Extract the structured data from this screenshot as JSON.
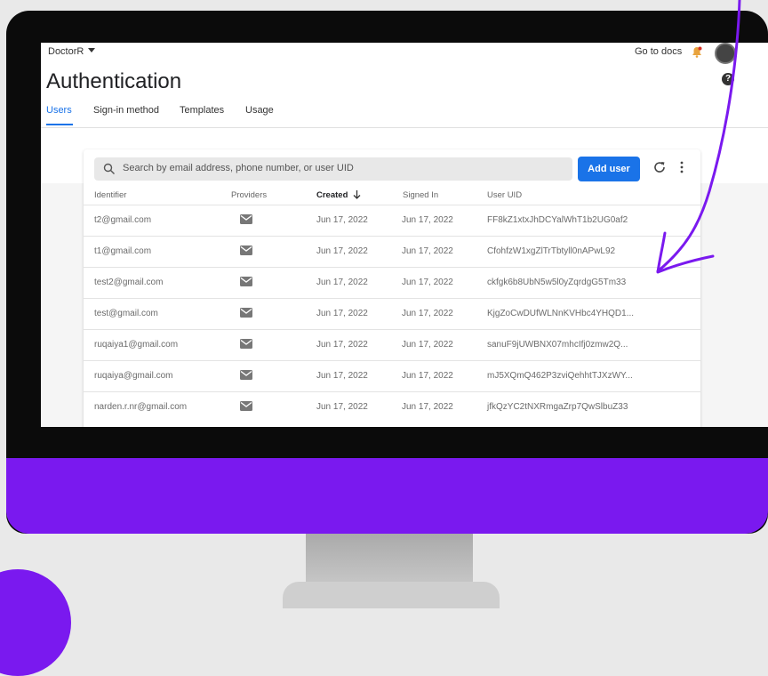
{
  "header": {
    "project": "DoctorR",
    "docs_link": "Go to docs",
    "title": "Authentication"
  },
  "tabs": [
    {
      "label": "Users",
      "active": true
    },
    {
      "label": "Sign-in method",
      "active": false
    },
    {
      "label": "Templates",
      "active": false
    },
    {
      "label": "Usage",
      "active": false
    }
  ],
  "search": {
    "placeholder": "Search by email address, phone number, or user UID"
  },
  "toolbar": {
    "add_user_label": "Add user"
  },
  "table": {
    "columns": [
      "Identifier",
      "Providers",
      "Created",
      "Signed In",
      "User UID"
    ],
    "sort_column": "Created",
    "sort_direction": "descending",
    "rows": [
      {
        "identifier": "t2@gmail.com",
        "provider": "email-icon",
        "created": "Jun 17, 2022",
        "signed_in": "Jun 17, 2022",
        "uid": "FF8kZ1xtxJhDCYalWhT1b2UG0af2"
      },
      {
        "identifier": "t1@gmail.com",
        "provider": "email-icon",
        "created": "Jun 17, 2022",
        "signed_in": "Jun 17, 2022",
        "uid": "CfohfzW1xgZlTrTbtyll0nAPwL92"
      },
      {
        "identifier": "test2@gmail.com",
        "provider": "email-icon",
        "created": "Jun 17, 2022",
        "signed_in": "Jun 17, 2022",
        "uid": "ckfgk6b8UbN5w5l0yZqrdgG5Tm33"
      },
      {
        "identifier": "test@gmail.com",
        "provider": "email-icon",
        "created": "Jun 17, 2022",
        "signed_in": "Jun 17, 2022",
        "uid": "KjgZoCwDUfWLNnKVHbc4YHQD1..."
      },
      {
        "identifier": "ruqaiya1@gmail.com",
        "provider": "email-icon",
        "created": "Jun 17, 2022",
        "signed_in": "Jun 17, 2022",
        "uid": "sanuF9jUWBNX07mhcIfj0zmw2Q..."
      },
      {
        "identifier": "ruqaiya@gmail.com",
        "provider": "email-icon",
        "created": "Jun 17, 2022",
        "signed_in": "Jun 17, 2022",
        "uid": "mJ5XQmQ462P3zviQehhtTJXzWY..."
      },
      {
        "identifier": "narden.r.nr@gmail.com",
        "provider": "email-icon",
        "created": "Jun 17, 2022",
        "signed_in": "Jun 17, 2022",
        "uid": "jfkQzYC2tNXRmgaZrp7QwSlbuZ33"
      }
    ]
  },
  "colors": {
    "accent": "#1a73e8",
    "monitor_chin": "#7a19ef",
    "bezel": "#0b0b0b",
    "annotation_arrow": "#7a19ef"
  }
}
